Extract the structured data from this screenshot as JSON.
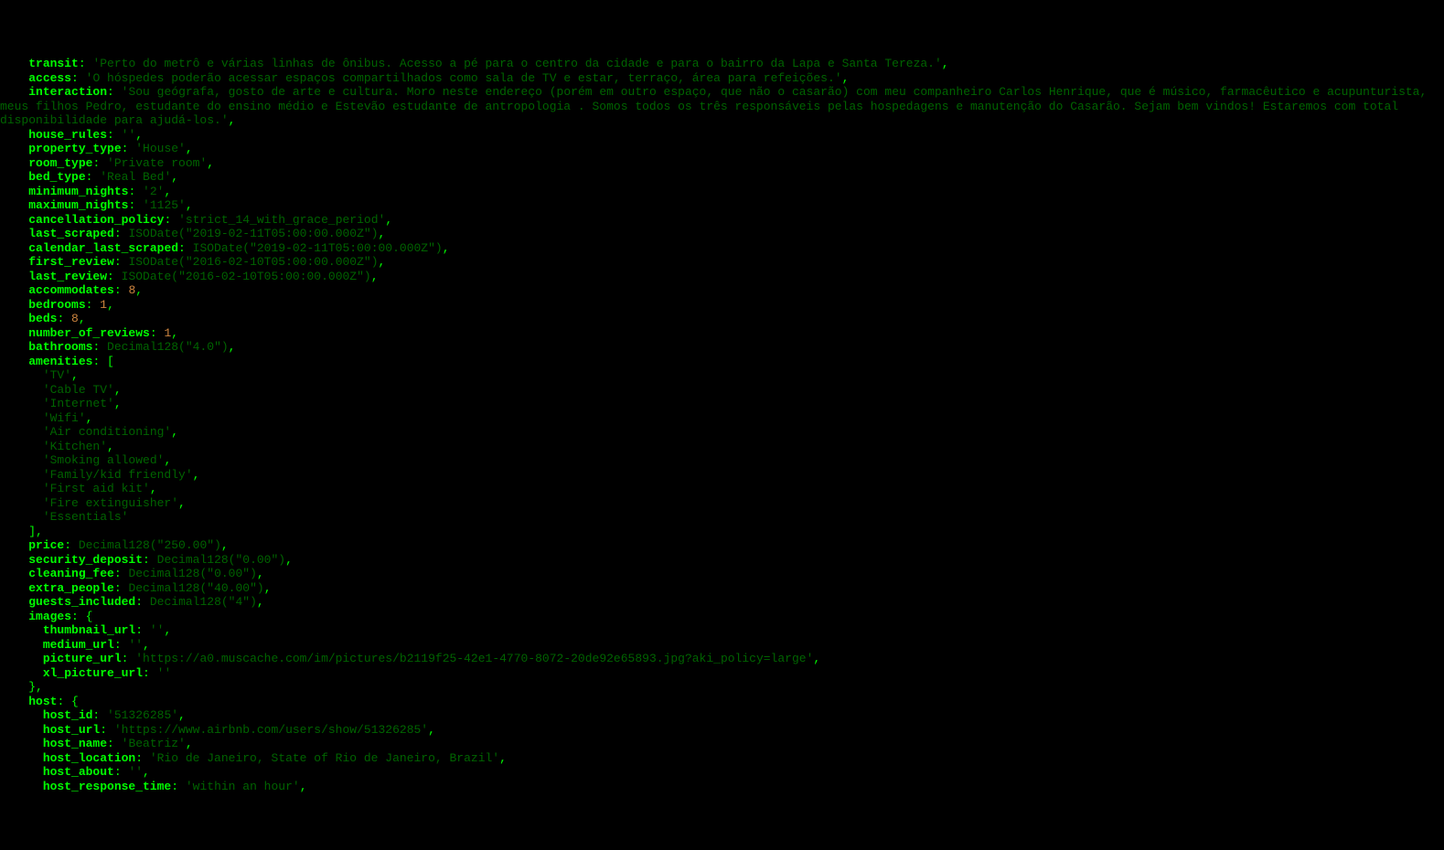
{
  "indent1": "    ",
  "indent2": "      ",
  "transit_key": "transit",
  "transit_val": "'Perto do metrô e várias linhas de ônibus. Acesso a pé para o centro da cidade e para o bairro da Lapa e Santa Tereza.'",
  "access_key": "access",
  "access_val": "'O hóspedes poderão acessar espaços compartilhados como sala de TV e estar, terraço, área para refeições.'",
  "interaction_key": "interaction",
  "interaction_val": "'Sou geógrafa, gosto de arte e cultura. Moro neste endereço (porém em outro espaço, que não o casarão) com meu companheiro Carlos Henrique, que é músico, farmacêutico e acupunturista, meus filhos Pedro, estudante do ensino médio e Estevão estudante de antropologia . Somos todos os três responsáveis pelas hospedagens e manutenção do Casarão. Sejam bem vindos! Estaremos com total disponibilidade para ajudá-los.'",
  "house_rules_key": "house_rules",
  "house_rules_val": "''",
  "property_type_key": "property_type",
  "property_type_val": "'House'",
  "room_type_key": "room_type",
  "room_type_val": "'Private room'",
  "bed_type_key": "bed_type",
  "bed_type_val": "'Real Bed'",
  "minimum_nights_key": "minimum_nights",
  "minimum_nights_val": "'2'",
  "maximum_nights_key": "maximum_nights",
  "maximum_nights_val": "'1125'",
  "cancellation_policy_key": "cancellation_policy",
  "cancellation_policy_val": "'strict_14_with_grace_period'",
  "last_scraped_key": "last_scraped",
  "last_scraped_val": "ISODate(\"2019-02-11T05:00:00.000Z\")",
  "calendar_last_scraped_key": "calendar_last_scraped",
  "calendar_last_scraped_val": "ISODate(\"2019-02-11T05:00:00.000Z\")",
  "first_review_key": "first_review",
  "first_review_val": "ISODate(\"2016-02-10T05:00:00.000Z\")",
  "last_review_key": "last_review",
  "last_review_val": "ISODate(\"2016-02-10T05:00:00.000Z\")",
  "accommodates_key": "accommodates",
  "accommodates_val": "8",
  "bedrooms_key": "bedrooms",
  "bedrooms_val": "1",
  "beds_key": "beds",
  "beds_val": "8",
  "number_of_reviews_key": "number_of_reviews",
  "number_of_reviews_val": "1",
  "bathrooms_key": "bathrooms",
  "bathrooms_val": "Decimal128(\"4.0\")",
  "amenities_key": "amenities",
  "amenities": [
    "'TV'",
    "'Cable TV'",
    "'Internet'",
    "'Wifi'",
    "'Air conditioning'",
    "'Kitchen'",
    "'Smoking allowed'",
    "'Family/kid friendly'",
    "'First aid kit'",
    "'Fire extinguisher'",
    "'Essentials'"
  ],
  "price_key": "price",
  "price_val": "Decimal128(\"250.00\")",
  "security_deposit_key": "security_deposit",
  "security_deposit_val": "Decimal128(\"0.00\")",
  "cleaning_fee_key": "cleaning_fee",
  "cleaning_fee_val": "Decimal128(\"0.00\")",
  "extra_people_key": "extra_people",
  "extra_people_val": "Decimal128(\"40.00\")",
  "guests_included_key": "guests_included",
  "guests_included_val": "Decimal128(\"4\")",
  "images_key": "images",
  "thumbnail_url_key": "thumbnail_url",
  "thumbnail_url_val": "''",
  "medium_url_key": "medium_url",
  "medium_url_val": "''",
  "picture_url_key": "picture_url",
  "picture_url_val": "'https://a0.muscache.com/im/pictures/b2119f25-42e1-4770-8072-20de92e65893.jpg?aki_policy=large'",
  "xl_picture_url_key": "xl_picture_url",
  "xl_picture_url_val": "''",
  "host_key": "host",
  "host_id_key": "host_id",
  "host_id_val": "'51326285'",
  "host_url_key": "host_url",
  "host_url_val": "'https://www.airbnb.com/users/show/51326285'",
  "host_name_key": "host_name",
  "host_name_val": "'Beatriz'",
  "host_location_key": "host_location",
  "host_location_val": "'Rio de Janeiro, State of Rio de Janeiro, Brazil'",
  "host_about_key": "host_about",
  "host_about_val": "''",
  "host_response_time_key": "host_response_time",
  "host_response_time_val": "'within an hour'"
}
